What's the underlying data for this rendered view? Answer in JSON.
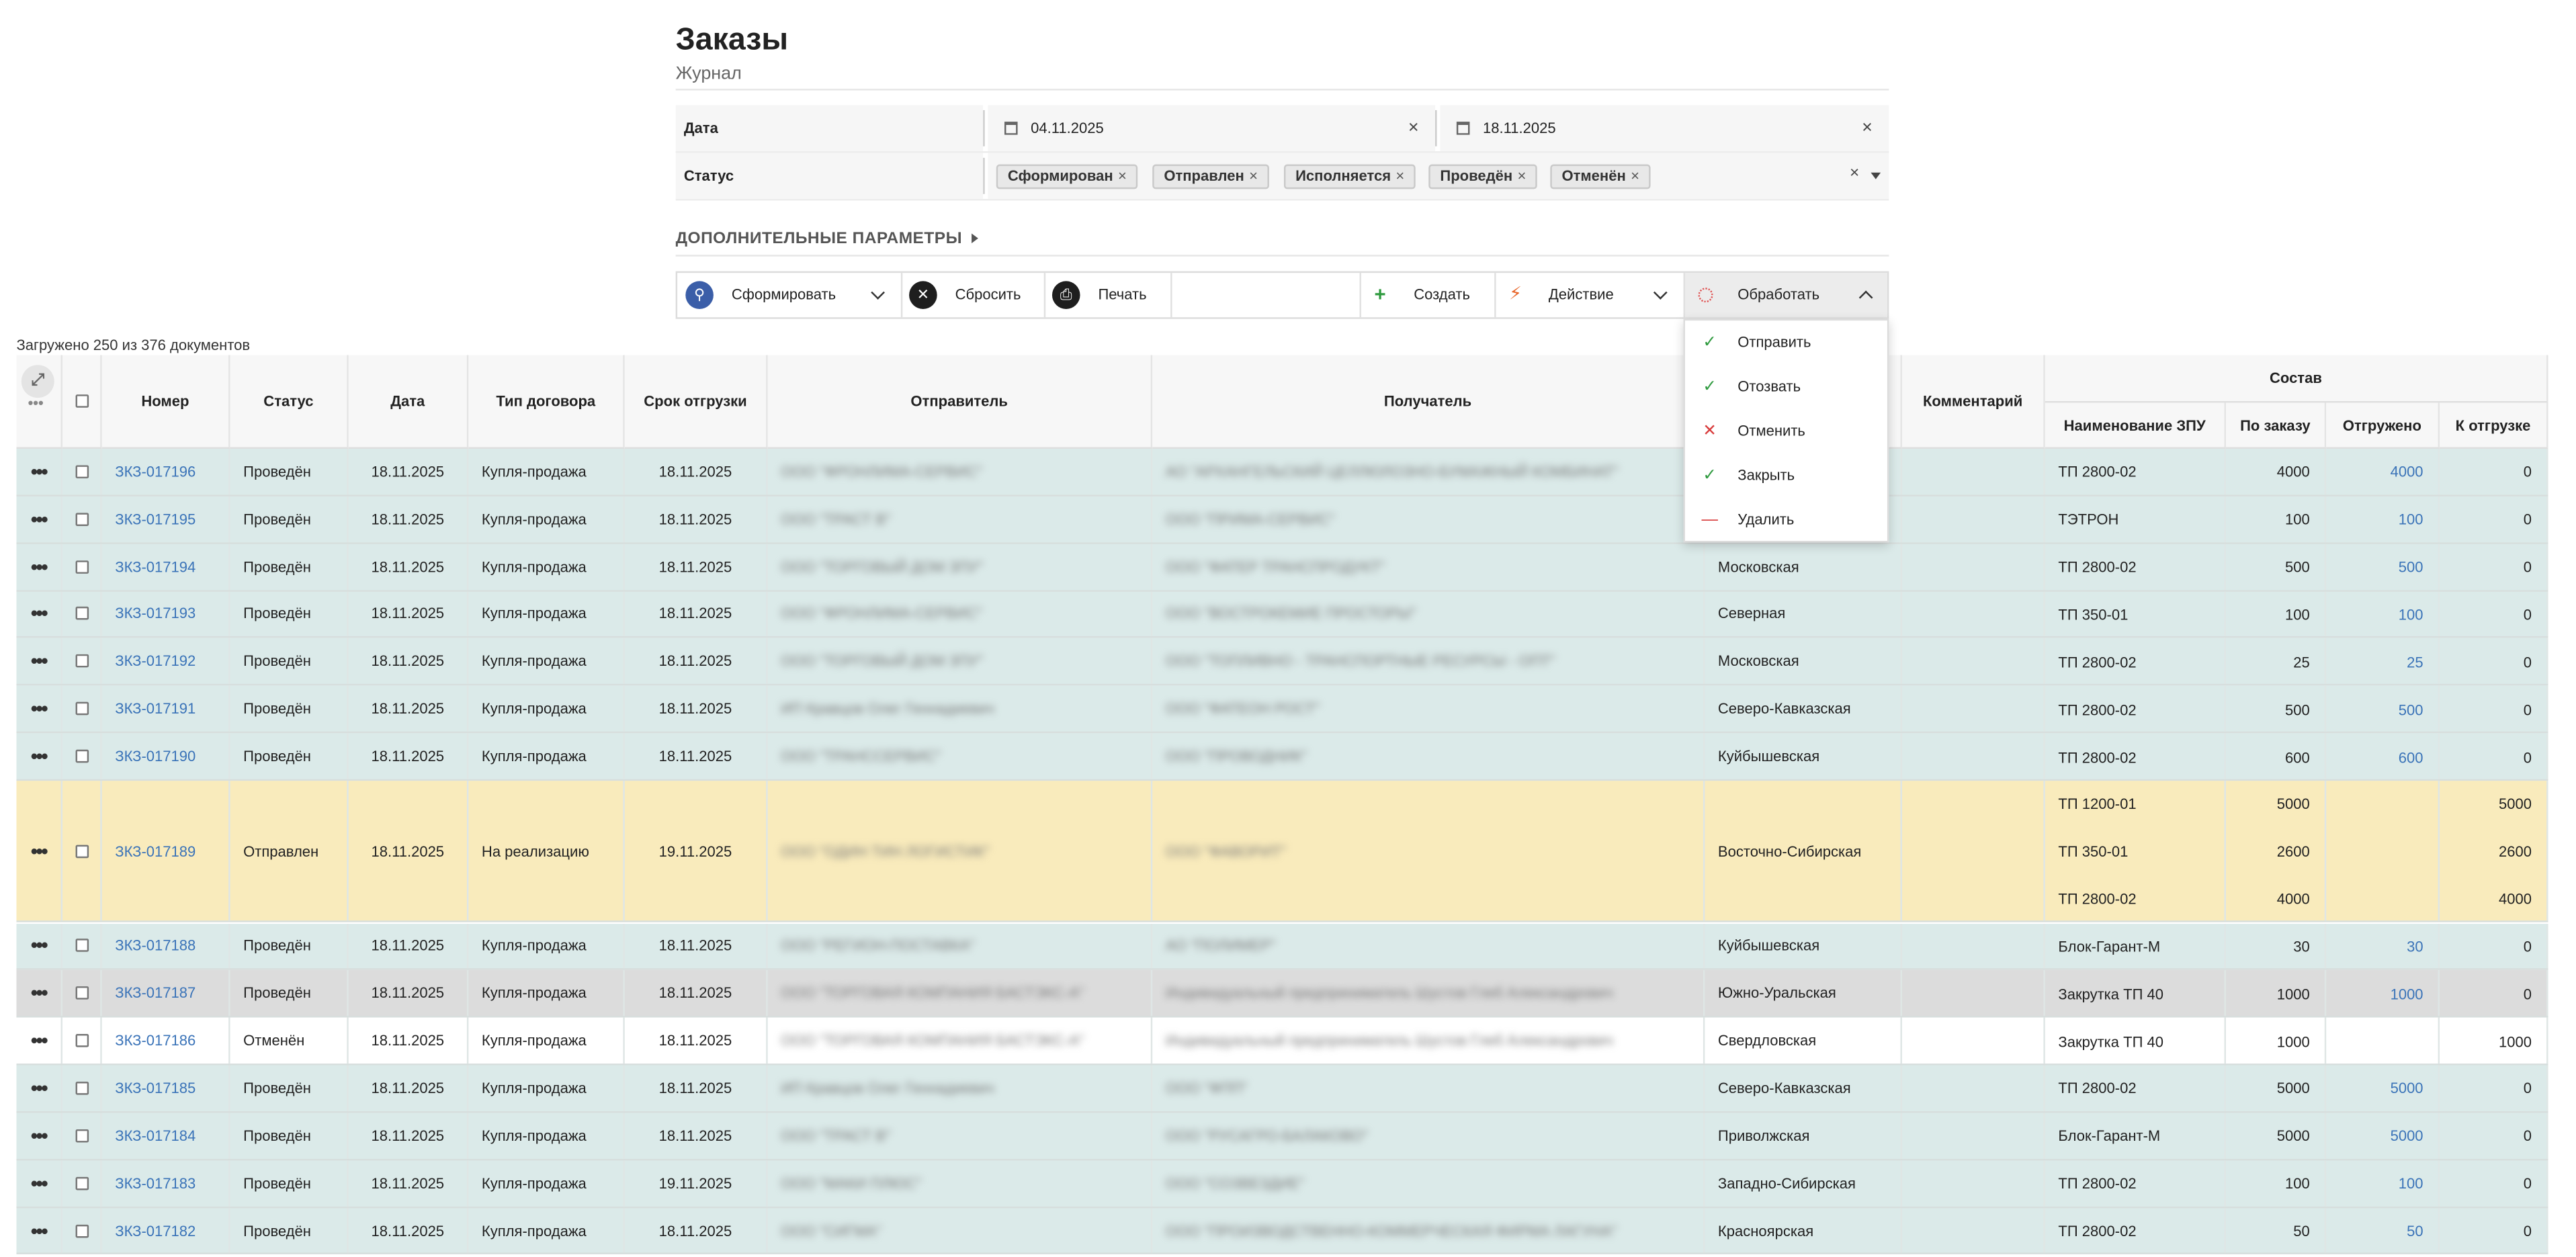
{
  "header": {
    "title": "Заказы",
    "subtitle": "Журнал"
  },
  "filters": {
    "date_label": "Дата",
    "date_from": "04.11.2025",
    "date_to": "18.11.2025",
    "status_label": "Статус",
    "status_chips": [
      "Сформирован",
      "Отправлен",
      "Исполняется",
      "Проведён",
      "Отменён"
    ],
    "clear_icon": "×",
    "chip_remove_icon": "×"
  },
  "extra_params_label": "ДОПОЛНИТЕЛЬНЫЕ ПАРАМЕТРЫ",
  "toolbar": {
    "form_label": "Сформировать",
    "reset_label": "Сбросить",
    "print_label": "Печать",
    "create_label": "Создать",
    "action_label": "Действие",
    "process_label": "Обработать"
  },
  "process_menu": [
    {
      "label": "Отправить",
      "icon": "check-icon",
      "glyph": "✓"
    },
    {
      "label": "Отозвать",
      "icon": "check-icon",
      "glyph": "✓"
    },
    {
      "label": "Отменить",
      "icon": "cross-icon",
      "glyph": "✕"
    },
    {
      "label": "Закрыть",
      "icon": "check-icon",
      "glyph": "✓"
    },
    {
      "label": "Удалить",
      "icon": "minus-icon",
      "glyph": "—"
    }
  ],
  "loaded_text": "Загружено 250 из 376 документов",
  "table": {
    "columns": {
      "number": "Номер",
      "status": "Статус",
      "date": "Дата",
      "contract": "Тип договора",
      "ship_date": "Срок отгрузки",
      "sender": "Отправитель",
      "receiver": "Получатель",
      "comment": "Комментарий",
      "composition": "Состав",
      "zpu_name": "Наименование ЗПУ",
      "ordered": "По заказу",
      "shipped": "Отгружено",
      "to_ship": "К отгрузке"
    },
    "rows": [
      {
        "number": "ЗКЗ-017196",
        "status": "Проведён",
        "date": "18.11.2025",
        "contract": "Купля-продажа",
        "ship_date": "18.11.2025",
        "sender": "ООО \"ФРОНЛИМА-СЕРВИС\"",
        "receiver": "АО \"АРХАНГЕЛЬСКИЙ ЦЕЛЛЮЛОЗНО-БУМАЖНЫЙ КОМБИНАТ\"",
        "road": "",
        "kind": "done",
        "items": [
          {
            "zpu": "ТП 2800-02",
            "ordered": "4000",
            "shipped": "4000",
            "to_ship": "0"
          }
        ]
      },
      {
        "number": "ЗКЗ-017195",
        "status": "Проведён",
        "date": "18.11.2025",
        "contract": "Купля-продажа",
        "ship_date": "18.11.2025",
        "sender": "ООО \"ТРАСТ В\"",
        "receiver": "ООО \"ПРИМА-СЕРВИС\"",
        "road": "",
        "kind": "done",
        "items": [
          {
            "zpu": "ТЭТРОН",
            "ordered": "100",
            "shipped": "100",
            "to_ship": "0"
          }
        ]
      },
      {
        "number": "ЗКЗ-017194",
        "status": "Проведён",
        "date": "18.11.2025",
        "contract": "Купля-продажа",
        "ship_date": "18.11.2025",
        "sender": "ООО \"ТОРГОВЫЙ ДОМ ЗПУ\"",
        "receiver": "ООО \"ФАТЕР ТРАНСПРОДУКТ\"",
        "road": "Московская",
        "kind": "done",
        "items": [
          {
            "zpu": "ТП 2800-02",
            "ordered": "500",
            "shipped": "500",
            "to_ship": "0"
          }
        ]
      },
      {
        "number": "ЗКЗ-017193",
        "status": "Проведён",
        "date": "18.11.2025",
        "contract": "Купля-продажа",
        "ship_date": "18.11.2025",
        "sender": "ООО \"ФРОНЛИМА-СЕРВИС\"",
        "receiver": "ООО \"ВОСТРОКЕМИЕ ПРОСТОРЫ\"",
        "road": "Северная",
        "kind": "done",
        "items": [
          {
            "zpu": "ТП 350-01",
            "ordered": "100",
            "shipped": "100",
            "to_ship": "0"
          }
        ]
      },
      {
        "number": "ЗКЗ-017192",
        "status": "Проведён",
        "date": "18.11.2025",
        "contract": "Купля-продажа",
        "ship_date": "18.11.2025",
        "sender": "ООО \"ТОРГОВЫЙ ДОМ ЗПУ\"",
        "receiver": "ООО \"ТОПЛИВНО - ТРАНСПОРТНЫЕ РЕСУРСЫ - ОПТ\"",
        "road": "Московская",
        "kind": "done",
        "items": [
          {
            "zpu": "ТП 2800-02",
            "ordered": "25",
            "shipped": "25",
            "to_ship": "0"
          }
        ]
      },
      {
        "number": "ЗКЗ-017191",
        "status": "Проведён",
        "date": "18.11.2025",
        "contract": "Купля-продажа",
        "ship_date": "18.11.2025",
        "sender": "ИП Кравцов Олег Геннадиевич",
        "receiver": "ООО \"ФАТЕОН РОСТ\"",
        "road": "Северо-Кавказская",
        "kind": "done",
        "items": [
          {
            "zpu": "ТП 2800-02",
            "ordered": "500",
            "shipped": "500",
            "to_ship": "0"
          }
        ]
      },
      {
        "number": "ЗКЗ-017190",
        "status": "Проведён",
        "date": "18.11.2025",
        "contract": "Купля-продажа",
        "ship_date": "18.11.2025",
        "sender": "ООО \"ТРАНССЕРВИС\"",
        "receiver": "ООО \"ПРОВОДНИК\"",
        "road": "Куйбышевская",
        "kind": "done",
        "items": [
          {
            "zpu": "ТП 2800-02",
            "ordered": "600",
            "shipped": "600",
            "to_ship": "0"
          }
        ]
      },
      {
        "number": "ЗКЗ-017189",
        "status": "Отправлен",
        "date": "18.11.2025",
        "contract": "На реализацию",
        "ship_date": "19.11.2025",
        "sender": "ООО \"ОДИН ТИН ЛОГИСТИК\"",
        "receiver": "ООО \"ФАВОРИТ\"",
        "road": "Восточно-Сибирская",
        "kind": "sent",
        "items": [
          {
            "zpu": "ТП 1200-01",
            "ordered": "5000",
            "shipped": "",
            "to_ship": "5000"
          },
          {
            "zpu": "ТП 350-01",
            "ordered": "2600",
            "shipped": "",
            "to_ship": "2600"
          },
          {
            "zpu": "ТП 2800-02",
            "ordered": "4000",
            "shipped": "",
            "to_ship": "4000"
          }
        ]
      },
      {
        "number": "ЗКЗ-017188",
        "status": "Проведён",
        "date": "18.11.2025",
        "contract": "Купля-продажа",
        "ship_date": "18.11.2025",
        "sender": "ООО \"РЕГИОН-ПОСТАВКА\"",
        "receiver": "АО \"ПОЛИМЕР\"",
        "road": "Куйбышевская",
        "kind": "done",
        "items": [
          {
            "zpu": "Блок-Гарант-М",
            "ordered": "30",
            "shipped": "30",
            "to_ship": "0"
          }
        ]
      },
      {
        "number": "ЗКЗ-017187",
        "status": "Проведён",
        "date": "18.11.2025",
        "contract": "Купля-продажа",
        "ship_date": "18.11.2025",
        "sender": "ООО \"ТОРГОВАЯ КОМПАНИЯ БАСТЭКС-А\"",
        "receiver": "Индивидуальный предприниматель Шустов Глеб Александрович",
        "road": "Южно-Уральская",
        "kind": "selected",
        "items": [
          {
            "zpu": "Закрутка ТП 40",
            "ordered": "1000",
            "shipped": "1000",
            "to_ship": "0"
          }
        ]
      },
      {
        "number": "ЗКЗ-017186",
        "status": "Отменён",
        "date": "18.11.2025",
        "contract": "Купля-продажа",
        "ship_date": "18.11.2025",
        "sender": "ООО \"ТОРГОВАЯ КОМПАНИЯ БАСТЭКС-А\"",
        "receiver": "Индивидуальный предприниматель Шустов Глеб Александрович",
        "road": "Свердловская",
        "kind": "cancelled",
        "items": [
          {
            "zpu": "Закрутка ТП 40",
            "ordered": "1000",
            "shipped": "",
            "to_ship": "1000"
          }
        ]
      },
      {
        "number": "ЗКЗ-017185",
        "status": "Проведён",
        "date": "18.11.2025",
        "contract": "Купля-продажа",
        "ship_date": "18.11.2025",
        "sender": "ИП Кравцов Олег Геннадиевич",
        "receiver": "ООО \"ФПП\"",
        "road": "Северо-Кавказская",
        "kind": "done",
        "items": [
          {
            "zpu": "ТП 2800-02",
            "ordered": "5000",
            "shipped": "5000",
            "to_ship": "0"
          }
        ]
      },
      {
        "number": "ЗКЗ-017184",
        "status": "Проведён",
        "date": "18.11.2025",
        "contract": "Купля-продажа",
        "ship_date": "18.11.2025",
        "sender": "ООО \"ТРАСТ В\"",
        "receiver": "ООО \"РУСАГРО-БАЛАКОВО\"",
        "road": "Приволжская",
        "kind": "done",
        "items": [
          {
            "zpu": "Блок-Гарант-М",
            "ordered": "5000",
            "shipped": "5000",
            "to_ship": "0"
          }
        ]
      },
      {
        "number": "ЗКЗ-017183",
        "status": "Проведён",
        "date": "18.11.2025",
        "contract": "Купля-продажа",
        "ship_date": "19.11.2025",
        "sender": "ООО \"МАКИ ПЛЮС\"",
        "receiver": "ООО \"СОЗВЕЗДИЕ\"",
        "road": "Западно-Сибирская",
        "kind": "done",
        "items": [
          {
            "zpu": "ТП 2800-02",
            "ordered": "100",
            "shipped": "100",
            "to_ship": "0"
          }
        ]
      },
      {
        "number": "ЗКЗ-017182",
        "status": "Проведён",
        "date": "18.11.2025",
        "contract": "Купля-продажа",
        "ship_date": "18.11.2025",
        "sender": "ООО \"СИГМА\"",
        "receiver": "ООО \"ПРОИЗВОДСТВЕННО-КОММЕРЧЕСКАЯ ФИРМА ЛАГУНА\"",
        "road": "Красноярская",
        "kind": "done",
        "items": [
          {
            "zpu": "ТП 2800-02",
            "ordered": "50",
            "shipped": "50",
            "to_ship": "0"
          }
        ]
      }
    ]
  },
  "colors": {
    "done": "#dbeae9",
    "sent": "#f9ebbc",
    "selected": "#dcdcdc",
    "cancelled": "#ffffff",
    "link": "#3a73b8"
  }
}
